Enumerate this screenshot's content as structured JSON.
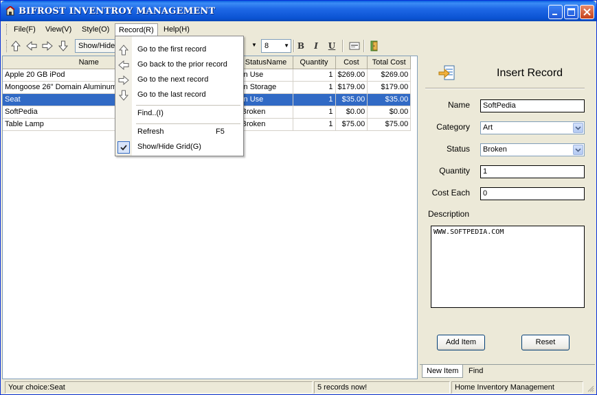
{
  "window": {
    "title": "BIFROST INVENTROY MANAGEMENT",
    "controls": [
      "minimize",
      "maximize",
      "close"
    ]
  },
  "menubar": {
    "items": [
      {
        "label": "File(F)"
      },
      {
        "label": "View(V)"
      },
      {
        "label": "Style(O)"
      },
      {
        "label": "Record(R)",
        "active": true
      },
      {
        "label": "Help(H)"
      }
    ]
  },
  "toolbar": {
    "nav_icons": [
      "arrow-up-icon",
      "arrow-left-icon",
      "arrow-right-icon",
      "arrow-down-icon"
    ],
    "showhide_label": "Show/Hide",
    "font_size_value": "8",
    "format_buttons": [
      "B",
      "I",
      "U"
    ],
    "extra_icons": [
      "form-icon",
      "exit-door-icon"
    ]
  },
  "grid": {
    "columns": [
      "Name",
      "",
      "StatusName",
      "Quantity",
      "Cost",
      "Total Cost"
    ],
    "rows": [
      {
        "name": "Apple 20 GB iPod",
        "status": "In Use",
        "quantity": "1",
        "cost": "$269.00",
        "total": "$269.00"
      },
      {
        "name": "Mongoose 26\" Domain Aluminum F",
        "status": "In Storage",
        "quantity": "1",
        "cost": "$179.00",
        "total": "$179.00"
      },
      {
        "name": "Seat",
        "status": "In Use",
        "quantity": "1",
        "cost": "$35.00",
        "total": "$35.00",
        "selected": true
      },
      {
        "name": "SoftPedia",
        "status": "Broken",
        "quantity": "1",
        "cost": "$0.00",
        "total": "$0.00"
      },
      {
        "name": "Table Lamp",
        "status": "Broken",
        "quantity": "1",
        "cost": "$75.00",
        "total": "$75.00"
      }
    ]
  },
  "record_menu": {
    "items": [
      {
        "label": "Go to the first record",
        "icon": "arrow-up-icon"
      },
      {
        "label": "Go back to the prior record",
        "icon": "arrow-left-icon"
      },
      {
        "label": "Go to the next record",
        "icon": "arrow-right-icon"
      },
      {
        "label": "Go to the last record",
        "icon": "arrow-down-icon"
      },
      {
        "label": "Find..(I)"
      },
      {
        "label": "Refresh",
        "shortcut": "F5"
      },
      {
        "label": "Show/Hide Grid(G)",
        "checked": true
      }
    ]
  },
  "insert_panel": {
    "title": "Insert Record",
    "icon": "insert-record-icon",
    "fields": {
      "name_label": "Name",
      "name_value": "SoftPedia",
      "category_label": "Category",
      "category_value": "Art",
      "status_label": "Status",
      "status_value": "Broken",
      "quantity_label": "Quantity",
      "quantity_value": "1",
      "cost_each_label": "Cost Each",
      "cost_each_value": "0",
      "description_label": "Description",
      "description_value": "WWW.SOFTPEDIA.COM"
    },
    "add_button": "Add Item",
    "reset_button": "Reset",
    "tabs": [
      {
        "label": "New Item",
        "active": true
      },
      {
        "label": "Find"
      }
    ]
  },
  "statusbar": {
    "choice": "Your choice:Seat",
    "records": "5  records  now!",
    "app_name": "Home Inventory Management"
  },
  "colors": {
    "titlebar": "#0b53d3",
    "selection": "#316ac5",
    "window_bg": "#ece9d8"
  }
}
